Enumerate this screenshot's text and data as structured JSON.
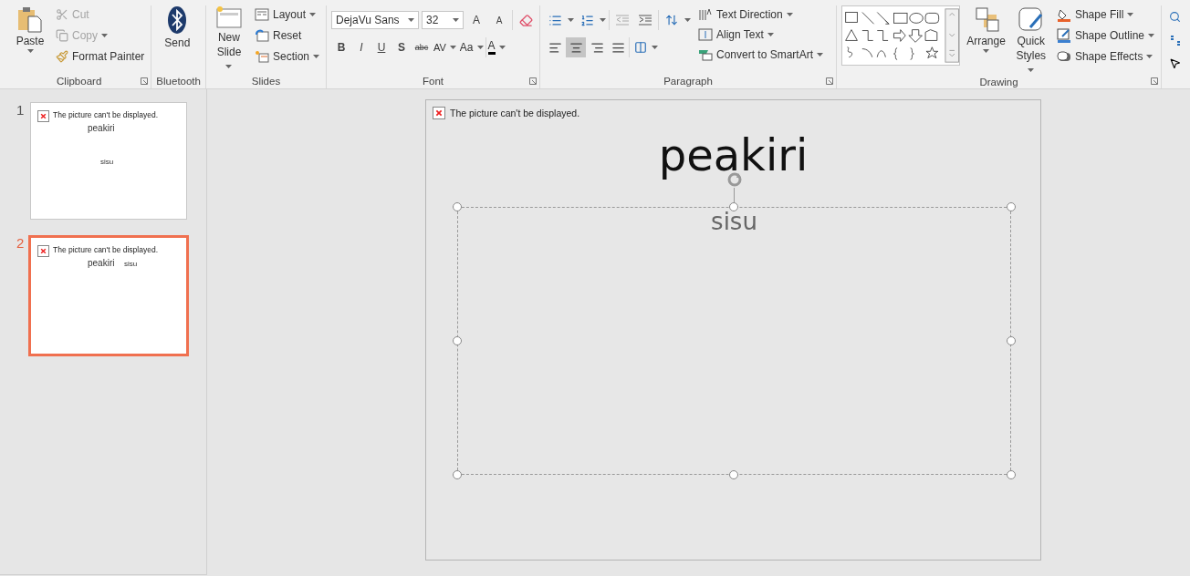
{
  "ribbon": {
    "clipboard": {
      "label": "Clipboard",
      "paste": "Paste",
      "cut": {
        "label": "Cut",
        "disabled": true
      },
      "copy": {
        "label": "Copy",
        "disabled": true
      },
      "format_painter": {
        "label": "Format Painter",
        "disabled": false
      }
    },
    "bluetooth": {
      "label": "Bluetooth",
      "send": "Send"
    },
    "slides": {
      "label": "Slides",
      "new_slide": [
        "New",
        "Slide"
      ],
      "layout": "Layout",
      "reset": "Reset",
      "section": "Section"
    },
    "font": {
      "label": "Font",
      "font_name": "DejaVu Sans",
      "font_size": "32",
      "grow": "A",
      "shrink": "A",
      "styles": [
        "B",
        "I",
        "U",
        "S",
        "abc"
      ],
      "spacing": "AV",
      "change_case": "Aa",
      "font_color": "A"
    },
    "paragraph": {
      "label": "Paragraph",
      "alignments": [
        {
          "selected": false
        },
        {
          "selected": true
        },
        {
          "selected": false
        },
        {
          "selected": false
        }
      ],
      "text_direction": "Text Direction",
      "align_text": "Align Text",
      "convert": "Convert to SmartArt"
    },
    "drawing": {
      "label": "Drawing",
      "arrange": "Arrange",
      "quick_styles": [
        "Quick",
        "Styles"
      ],
      "shape_fill": "Shape Fill",
      "shape_outline": "Shape Outline",
      "shape_effects": "Shape Effects"
    }
  },
  "slides_pane": [
    {
      "number": "1",
      "selected": false,
      "picture_error": "The picture can't be displayed.",
      "title": "peakiri",
      "subtitle": "sisu"
    },
    {
      "number": "2",
      "selected": true,
      "picture_error": "The picture can't be displayed.",
      "title": "peakiri",
      "subtitle": "sisu"
    }
  ],
  "slide": {
    "picture_error": "The picture can't be displayed.",
    "title": "peakiri",
    "subtitle": "sisu"
  }
}
